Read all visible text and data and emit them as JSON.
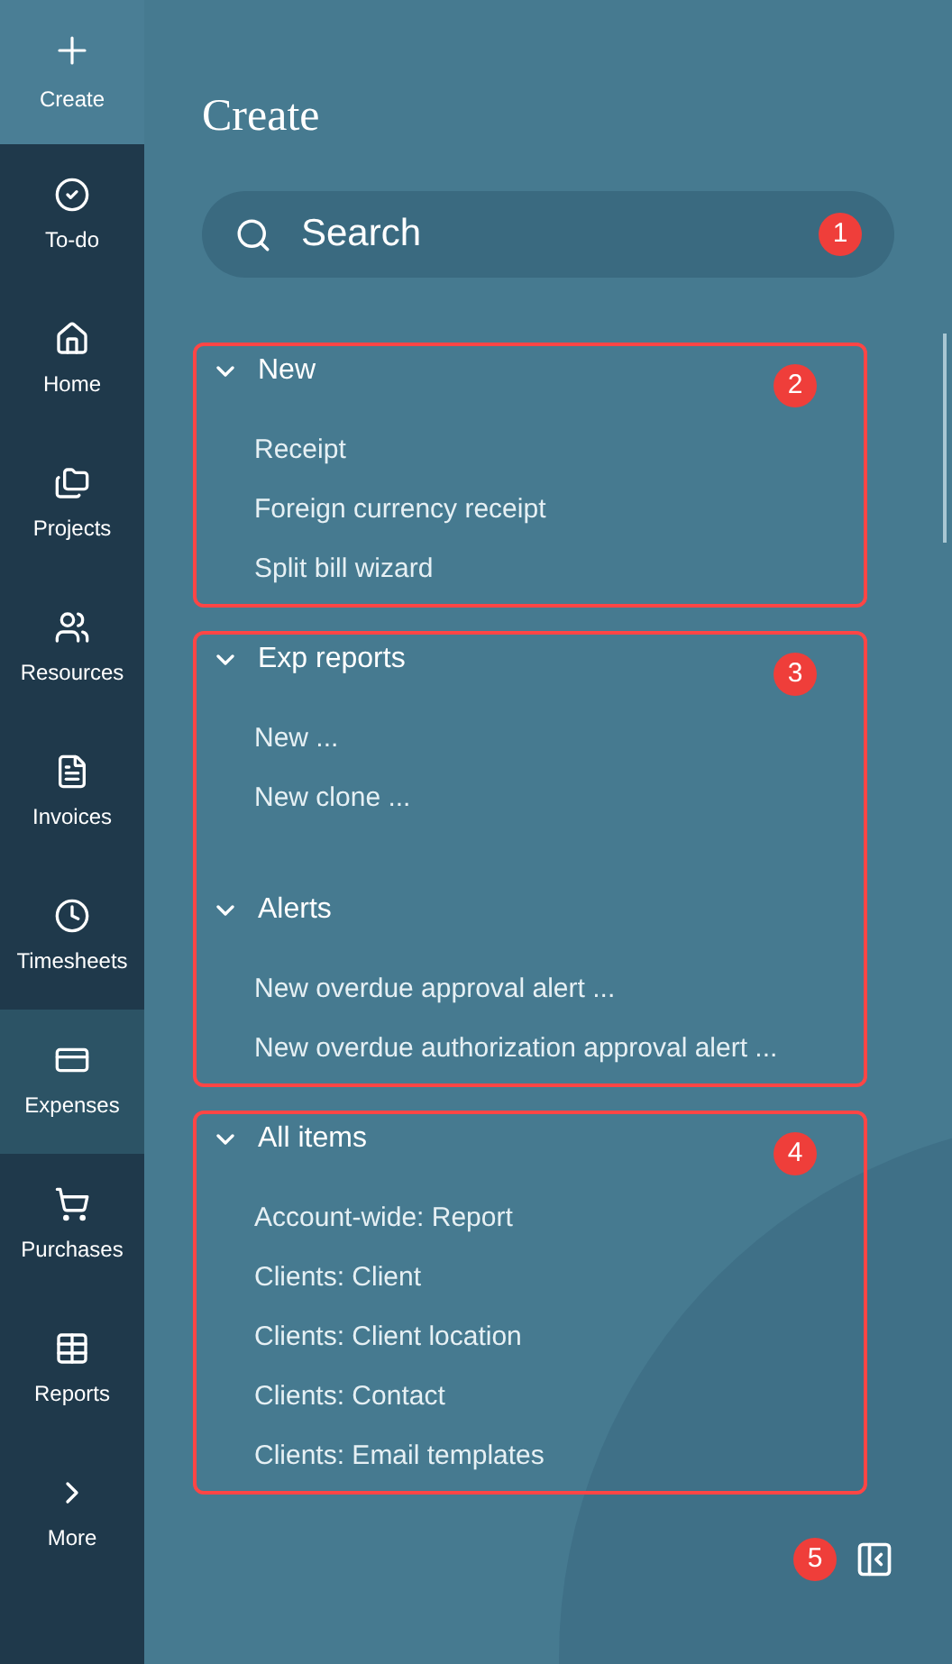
{
  "sidebar": {
    "items": [
      {
        "label": "Create",
        "kind": "create",
        "selected": true
      },
      {
        "label": "To-do",
        "kind": "nav",
        "selected": false
      },
      {
        "label": "Home",
        "kind": "nav",
        "selected": false
      },
      {
        "label": "Projects",
        "kind": "nav",
        "selected": false
      },
      {
        "label": "Resources",
        "kind": "nav",
        "selected": false
      },
      {
        "label": "Invoices",
        "kind": "nav",
        "selected": false
      },
      {
        "label": "Timesheets",
        "kind": "nav",
        "selected": false
      },
      {
        "label": "Expenses",
        "kind": "nav",
        "selected": true
      },
      {
        "label": "Purchases",
        "kind": "nav",
        "selected": false
      },
      {
        "label": "Reports",
        "kind": "nav",
        "selected": false
      },
      {
        "label": "More",
        "kind": "nav",
        "selected": false
      }
    ]
  },
  "panel": {
    "title": "Create",
    "search": {
      "placeholder": "Search",
      "callout": "1"
    },
    "sections": [
      {
        "callout": "2",
        "groups": [
          {
            "heading": "New",
            "expanded": true,
            "items": [
              "Receipt",
              "Foreign currency receipt",
              "Split bill wizard"
            ]
          }
        ]
      },
      {
        "callout": "3",
        "groups": [
          {
            "heading": "Exp reports",
            "expanded": true,
            "items": [
              "New ...",
              "New clone ..."
            ]
          },
          {
            "heading": "Alerts",
            "expanded": true,
            "items": [
              "New overdue approval alert ...",
              "New overdue authorization approval alert ..."
            ]
          }
        ]
      },
      {
        "callout": "4",
        "groups": [
          {
            "heading": "All items",
            "expanded": true,
            "items": [
              "Account-wide: Report",
              "Clients: Client",
              "Clients: Client location",
              "Clients: Contact",
              "Clients: Email templates"
            ]
          }
        ]
      }
    ],
    "footer": {
      "callout": "5"
    }
  }
}
